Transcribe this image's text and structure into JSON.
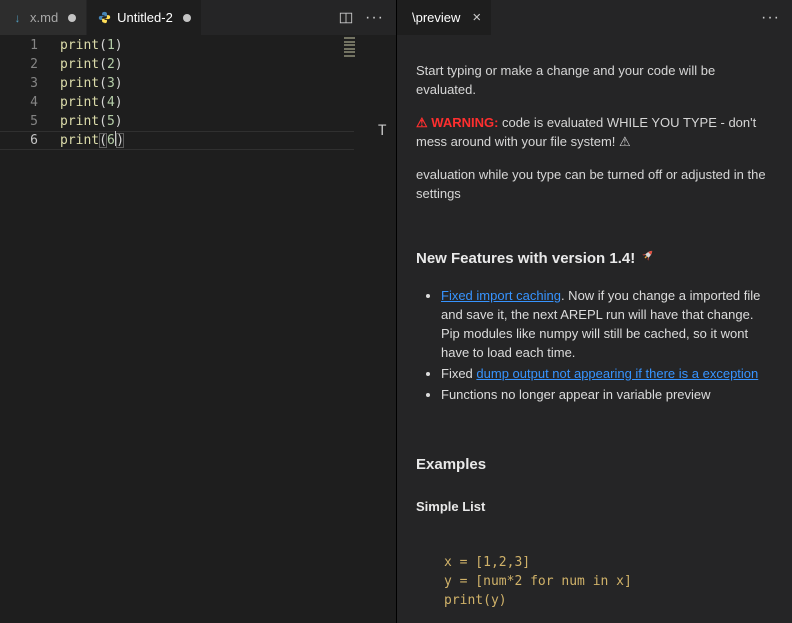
{
  "left_group": {
    "tabs": [
      {
        "label": "x.md",
        "icon": "markdown-icon",
        "modified": true,
        "active": false
      },
      {
        "label": "Untitled-2",
        "icon": "python-icon",
        "modified": true,
        "active": true
      }
    ],
    "actions": {
      "split_editor": "Split Editor",
      "more": "···"
    }
  },
  "editor": {
    "lines": [
      {
        "num": "1",
        "tokens": [
          {
            "t": "print",
            "c": "fn"
          },
          {
            "t": "(",
            "c": "pun"
          },
          {
            "t": "1",
            "c": "num"
          },
          {
            "t": ")",
            "c": "pun"
          }
        ]
      },
      {
        "num": "2",
        "tokens": [
          {
            "t": "print",
            "c": "fn"
          },
          {
            "t": "(",
            "c": "pun"
          },
          {
            "t": "2",
            "c": "num"
          },
          {
            "t": ")",
            "c": "pun"
          }
        ]
      },
      {
        "num": "3",
        "tokens": [
          {
            "t": "print",
            "c": "fn"
          },
          {
            "t": "(",
            "c": "pun"
          },
          {
            "t": "3",
            "c": "num"
          },
          {
            "t": ")",
            "c": "pun"
          }
        ]
      },
      {
        "num": "4",
        "tokens": [
          {
            "t": "print",
            "c": "fn"
          },
          {
            "t": "(",
            "c": "pun"
          },
          {
            "t": "4",
            "c": "num"
          },
          {
            "t": ")",
            "c": "pun"
          }
        ]
      },
      {
        "num": "5",
        "tokens": [
          {
            "t": "print",
            "c": "fn"
          },
          {
            "t": "(",
            "c": "pun"
          },
          {
            "t": "5",
            "c": "num"
          },
          {
            "t": ")",
            "c": "pun"
          }
        ]
      },
      {
        "num": "6",
        "active": true,
        "cursor_after": 2,
        "tokens": [
          {
            "t": "print",
            "c": "fn"
          },
          {
            "t": "(",
            "c": "pun",
            "m": true
          },
          {
            "t": "6",
            "c": "num"
          },
          {
            "t": ")",
            "c": "pun",
            "m": true
          }
        ]
      }
    ],
    "stray_text": "T"
  },
  "preview": {
    "tab_label": "\\preview",
    "close_label": "×",
    "more": "···",
    "intro": "Start typing or make a change and your code will be evaluated.",
    "warning_red": "⚠ WARNING:",
    "warning_rest": " code is evaluated WHILE YOU TYPE - don't mess around with your file system! ⚠",
    "settings_note": "evaluation while you type can be turned off or adjusted in the settings",
    "features_heading": "New Features with version 1.4!",
    "features_emoji_icon": "rocket-icon",
    "bullets": [
      {
        "parts": [
          {
            "link": "Fixed import caching"
          },
          {
            "text": ". Now if you change a imported file and save it, the next AREPL run will have that change. Pip modules like numpy will still be cached, so it wont have to load each time."
          }
        ]
      },
      {
        "parts": [
          {
            "text": "Fixed "
          },
          {
            "link": "dump output not appearing if there is a exception"
          }
        ]
      },
      {
        "parts": [
          {
            "text": "Functions no longer appear in variable preview"
          }
        ]
      }
    ],
    "examples_heading": "Examples",
    "simple_list_heading": "Simple List",
    "code_lines": [
      "x = [1,2,3]",
      "y = [num*2 for num in x]",
      "print(y)"
    ]
  },
  "colors": {
    "editor_bg": "#1e1e1e",
    "panel_bg": "#252526",
    "link": "#3794ff",
    "warning_red": "#ff2f2f",
    "function_token": "#dcdcaa",
    "number_token": "#b5cea8",
    "line_number": "#858585",
    "code_block_text": "#d0b269"
  }
}
